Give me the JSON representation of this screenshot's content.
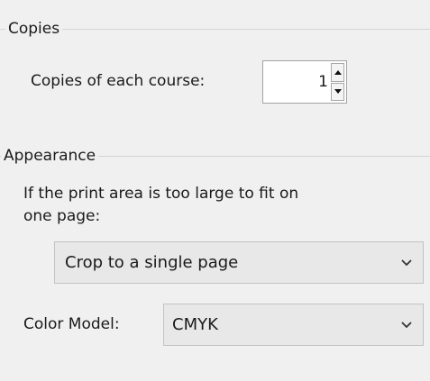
{
  "copies": {
    "section_title": "Copies",
    "copies_label": "Copies of each course:",
    "copies_value": "1"
  },
  "appearance": {
    "section_title": "Appearance",
    "print_area_label_line1": "If the print area is too large to fit on",
    "print_area_label_line2": "one page:",
    "print_area_selected": "Crop to a single page",
    "color_model_label": "Color Model:",
    "color_model_selected": "CMYK"
  },
  "icons": {
    "spin_up": "spin-up-arrow-icon",
    "spin_down": "spin-down-arrow-icon",
    "dropdown": "chevron-down-icon"
  }
}
